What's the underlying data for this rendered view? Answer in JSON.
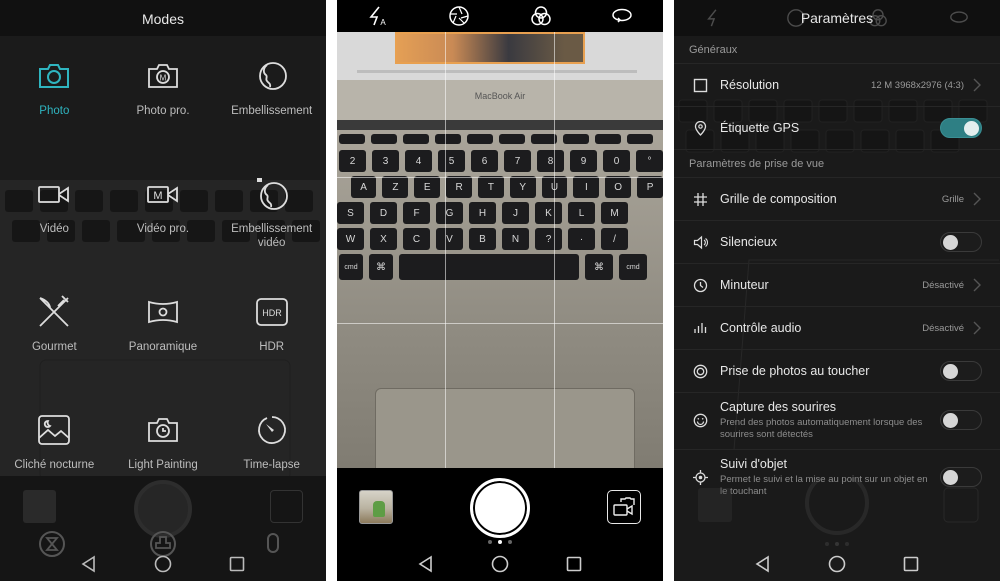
{
  "screen_modes": {
    "title": "Modes",
    "modes": [
      {
        "label": "Photo",
        "icon": "camera-icon",
        "active": true
      },
      {
        "label": "Photo pro.",
        "icon": "camera-manual-icon",
        "active": false
      },
      {
        "label": "Embellissement",
        "icon": "beauty-face-icon",
        "active": false
      },
      {
        "label": "Vidéo",
        "icon": "video-camera-icon",
        "active": false
      },
      {
        "label": "Vidéo pro.",
        "icon": "video-manual-icon",
        "active": false
      },
      {
        "label": "Embellissement vidéo",
        "icon": "beauty-video-icon",
        "active": false
      },
      {
        "label": "Gourmet",
        "icon": "knife-fork-icon",
        "active": false
      },
      {
        "label": "Panoramique",
        "icon": "panorama-icon",
        "active": false
      },
      {
        "label": "HDR",
        "icon": "hdr-icon",
        "active": false
      },
      {
        "label": "Cliché nocturne",
        "icon": "night-shot-icon",
        "active": false
      },
      {
        "label": "Light Painting",
        "icon": "light-painting-icon",
        "active": false
      },
      {
        "label": "Time-lapse",
        "icon": "time-lapse-icon",
        "active": false
      }
    ],
    "accent_color": "#2fb5c0"
  },
  "screen_camera": {
    "top_icons": [
      "flash-auto-icon",
      "aperture-icon",
      "filters-icon",
      "rotate-icon"
    ],
    "viewfinder": {
      "brand_text": "MacBook Air",
      "keyboard_rows": [
        [
          "2",
          "3",
          "4",
          "5",
          "6",
          "7",
          "8",
          "9",
          "0",
          "°"
        ],
        [
          "A",
          "Z",
          "E",
          "R",
          "T",
          "Y",
          "U",
          "I",
          "O",
          "P"
        ],
        [
          "S",
          "D",
          "F",
          "G",
          "H",
          "J",
          "K",
          "L",
          "M"
        ],
        [
          "W",
          "X",
          "C",
          "V",
          "B",
          "N",
          "?",
          "·",
          "/"
        ]
      ],
      "bottom_keys": [
        "cmd",
        "⌘",
        "⌘",
        "cmd"
      ]
    },
    "bottom": {
      "thumbnail": "last-photo-thumbnail",
      "shutter": "shutter-button",
      "switch": "switch-camera-icon",
      "page_dots": 3,
      "active_dot": 1
    }
  },
  "screen_settings": {
    "title": "Paramètres",
    "sections": [
      {
        "header": "Généraux",
        "rows": [
          {
            "label": "Résolution",
            "icon": "resolution-icon",
            "value": "12 M 3968x2976 (4:3)",
            "control": "chevron"
          },
          {
            "label": "Étiquette GPS",
            "icon": "location-pin-icon",
            "control": "toggle",
            "on": true
          }
        ]
      },
      {
        "header": "Paramètres de prise de vue",
        "rows": [
          {
            "label": "Grille de composition",
            "icon": "grid-icon",
            "value": "Grille",
            "control": "chevron"
          },
          {
            "label": "Silencieux",
            "icon": "speaker-icon",
            "control": "toggle",
            "on": false
          },
          {
            "label": "Minuteur",
            "icon": "clock-icon",
            "value": "Désactivé",
            "control": "chevron"
          },
          {
            "label": "Contrôle audio",
            "icon": "audio-bars-icon",
            "value": "Désactivé",
            "control": "chevron"
          },
          {
            "label": "Prise de photos au toucher",
            "icon": "touch-shot-icon",
            "control": "toggle",
            "on": false
          },
          {
            "label": "Capture des sourires",
            "icon": "smile-icon",
            "description": "Prend des photos automatiquement lorsque des sourires sont détectés",
            "control": "toggle",
            "on": false
          },
          {
            "label": "Suivi d'objet",
            "icon": "object-tracking-icon",
            "description": "Permet le suivi et la mise au point sur un objet en le touchant",
            "control": "toggle",
            "on": false
          }
        ]
      }
    ],
    "toggle_on_color": "#2e7f84"
  },
  "navbar": {
    "buttons": [
      "back-icon",
      "home-icon",
      "recents-icon"
    ]
  }
}
